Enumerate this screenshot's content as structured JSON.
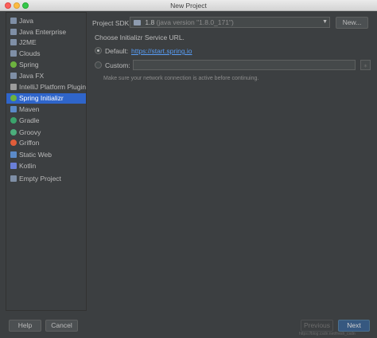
{
  "window": {
    "title": "New Project"
  },
  "sidebar": {
    "items": [
      {
        "label": "Java",
        "icon": "folder-icon",
        "color": "#7f8fa6"
      },
      {
        "label": "Java Enterprise",
        "icon": "folder-icon",
        "color": "#7f8fa6"
      },
      {
        "label": "J2ME",
        "icon": "j2me-icon",
        "color": "#7f8fa6"
      },
      {
        "label": "Clouds",
        "icon": "cloud-icon",
        "color": "#7f8fa6"
      },
      {
        "label": "Spring",
        "icon": "spring-icon",
        "color": "#6db33f"
      },
      {
        "label": "Java FX",
        "icon": "folder-icon",
        "color": "#7f8fa6"
      },
      {
        "label": "IntelliJ Platform Plugin",
        "icon": "plugin-icon",
        "color": "#9c9c9c"
      },
      {
        "label": "Spring Initializr",
        "icon": "spring-initializr-icon",
        "color": "#6db33f",
        "selected": true
      },
      {
        "label": "Maven",
        "icon": "maven-icon",
        "color": "#5b8ac8"
      },
      {
        "label": "Gradle",
        "icon": "gradle-icon",
        "color": "#3ba46c"
      },
      {
        "label": "Groovy",
        "icon": "groovy-icon",
        "color": "#4cae7c"
      },
      {
        "label": "Griffon",
        "icon": "griffon-icon",
        "color": "#e05d3a"
      },
      {
        "label": "Static Web",
        "icon": "static-web-icon",
        "color": "#5b8ac8"
      },
      {
        "label": "Kotlin",
        "icon": "kotlin-icon",
        "color": "#6a7fd8"
      },
      {
        "label": "Empty Project",
        "icon": "folder-icon",
        "color": "#7f8fa6"
      }
    ]
  },
  "main": {
    "sdk_label": "Project SDK:",
    "sdk_version": "1.8",
    "sdk_detail": "(java version \"1.8.0_171\")",
    "new_button": "New...",
    "choose_label": "Choose Initializr Service URL.",
    "default_label": "Default:",
    "default_url": "https://start.spring.io",
    "custom_label": "Custom:",
    "custom_value": "",
    "hint": "Make sure your network connection is active before continuing."
  },
  "footer": {
    "help": "Help",
    "cancel": "Cancel",
    "previous": "Previous",
    "next": "Next",
    "watermark": "https://blog.csdn.net/fresh_csdn"
  },
  "colors": {
    "accent": "#2f65ca",
    "link": "#589df6",
    "background": "#3c3f41"
  }
}
